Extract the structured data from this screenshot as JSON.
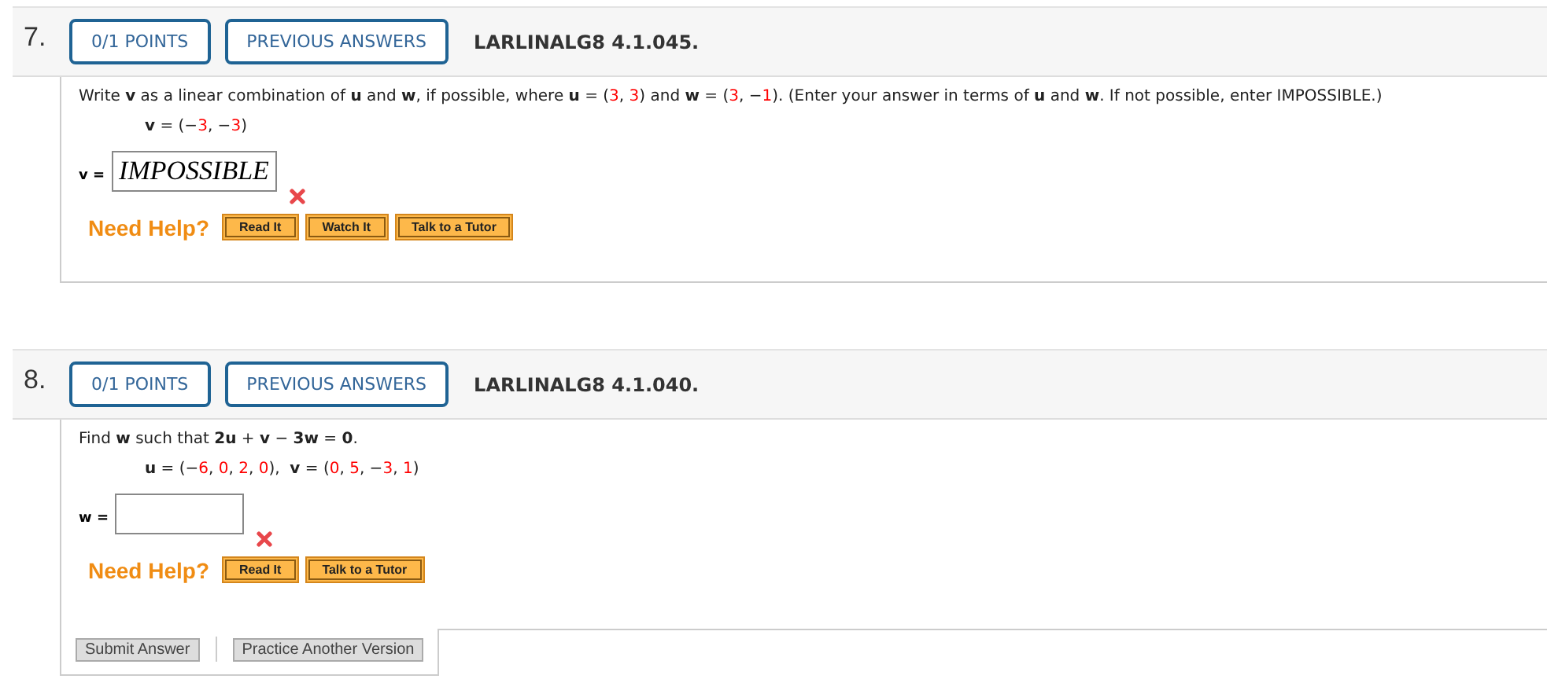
{
  "questions": [
    {
      "number": "7.",
      "points": "0/1 POINTS",
      "history": "PREVIOUS ANSWERS",
      "code": "LARLINALG8 4.1.045.",
      "prompt": [
        {
          "kind": "text",
          "text": "Write "
        },
        {
          "kind": "bold",
          "text": "v"
        },
        {
          "kind": "text",
          "text": " as a linear combination of "
        },
        {
          "kind": "bold",
          "text": "u"
        },
        {
          "kind": "text",
          "text": " and "
        },
        {
          "kind": "bold",
          "text": "w"
        },
        {
          "kind": "text",
          "text": ", if possible, where "
        },
        {
          "kind": "bold",
          "text": "u"
        },
        {
          "kind": "text",
          "text": " = ("
        },
        {
          "kind": "number",
          "text": "3"
        },
        {
          "kind": "text",
          "text": ", "
        },
        {
          "kind": "number",
          "text": "3"
        },
        {
          "kind": "text",
          "text": ") and "
        },
        {
          "kind": "bold",
          "text": "w"
        },
        {
          "kind": "text",
          "text": " = ("
        },
        {
          "kind": "number",
          "text": "3"
        },
        {
          "kind": "text",
          "text": ", −"
        },
        {
          "kind": "number",
          "text": "1"
        },
        {
          "kind": "text",
          "text": "). (Enter your answer in terms of "
        },
        {
          "kind": "bold",
          "text": "u"
        },
        {
          "kind": "text",
          "text": " and "
        },
        {
          "kind": "bold",
          "text": "w"
        },
        {
          "kind": "text",
          "text": ". If not possible, enter IMPOSSIBLE.)"
        }
      ],
      "given": [
        {
          "kind": "bold",
          "text": "v"
        },
        {
          "kind": "text",
          "text": " = (−"
        },
        {
          "kind": "number",
          "text": "3"
        },
        {
          "kind": "text",
          "text": ", −"
        },
        {
          "kind": "number",
          "text": "3"
        },
        {
          "kind": "text",
          "text": ")"
        }
      ],
      "answer": {
        "label": "v =",
        "value": "IMPOSSIBLE",
        "incorrect": true
      },
      "help_label": "Need Help?",
      "help_buttons": [
        "Read It",
        "Watch It",
        "Talk to a Tutor"
      ]
    },
    {
      "number": "8.",
      "points": "0/1 POINTS",
      "history": "PREVIOUS ANSWERS",
      "code": "LARLINALG8 4.1.040.",
      "prompt": [
        {
          "kind": "text",
          "text": "Find "
        },
        {
          "kind": "bold",
          "text": "w"
        },
        {
          "kind": "text",
          "text": " such that "
        },
        {
          "kind": "bold",
          "text": "2u"
        },
        {
          "kind": "text",
          "text": " + "
        },
        {
          "kind": "bold",
          "text": "v"
        },
        {
          "kind": "text",
          "text": " − "
        },
        {
          "kind": "bold",
          "text": "3w"
        },
        {
          "kind": "text",
          "text": " = "
        },
        {
          "kind": "bold",
          "text": "0"
        },
        {
          "kind": "text",
          "text": "."
        }
      ],
      "given": [
        {
          "kind": "bold",
          "text": "u"
        },
        {
          "kind": "text",
          "text": " = (−"
        },
        {
          "kind": "number",
          "text": "6"
        },
        {
          "kind": "text",
          "text": ", "
        },
        {
          "kind": "number",
          "text": "0"
        },
        {
          "kind": "text",
          "text": ", "
        },
        {
          "kind": "number",
          "text": "2"
        },
        {
          "kind": "text",
          "text": ", "
        },
        {
          "kind": "number",
          "text": "0"
        },
        {
          "kind": "text",
          "text": "),  "
        },
        {
          "kind": "bold",
          "text": "v"
        },
        {
          "kind": "text",
          "text": " = ("
        },
        {
          "kind": "number",
          "text": "0"
        },
        {
          "kind": "text",
          "text": ", "
        },
        {
          "kind": "number",
          "text": "5"
        },
        {
          "kind": "text",
          "text": ", −"
        },
        {
          "kind": "number",
          "text": "3"
        },
        {
          "kind": "text",
          "text": ", "
        },
        {
          "kind": "number",
          "text": "1"
        },
        {
          "kind": "text",
          "text": ")"
        }
      ],
      "answer": {
        "label": "w =",
        "incorrect": true
      },
      "help_label": "Need Help?",
      "help_buttons": [
        "Read It",
        "Talk to a Tutor"
      ],
      "submit_buttons": [
        "Submit Answer",
        "Practice Another Version"
      ]
    }
  ]
}
